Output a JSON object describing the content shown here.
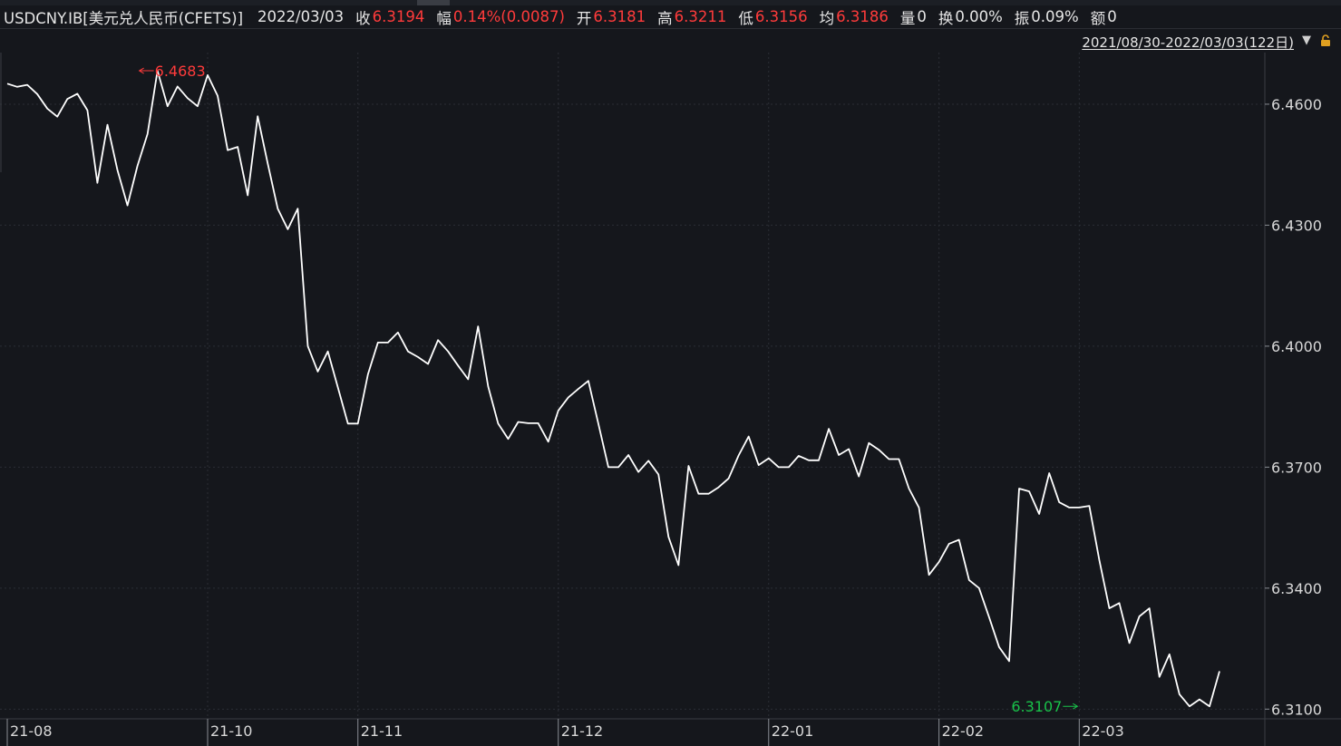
{
  "header": {
    "symbol": "USDCNY.IB[美元兑人民币(CFETS)]",
    "date": "2022/03/03",
    "close_label": "收",
    "close": "6.3194",
    "change_label": "幅",
    "change": "0.14%(0.0087)",
    "open_label": "开",
    "open": "6.3181",
    "high_label": "高",
    "high": "6.3211",
    "low_label": "低",
    "low": "6.3156",
    "avg_label": "均",
    "avg": "6.3186",
    "volume_label": "量",
    "volume": "0",
    "turnover_label": "换",
    "turnover": "0.00%",
    "amplitude_label": "振",
    "amplitude": "0.09%",
    "amount_label": "额",
    "amount": "0"
  },
  "range_selector": {
    "label": "2021/08/30-2022/03/03(122日)",
    "dropdown_icon": "triangle-down-icon",
    "lock_icon": "lock-icon"
  },
  "colors": {
    "background": "#15171c",
    "line": "#ffffff",
    "up": "#ff3b3b",
    "down": "#19c24a",
    "grid": "#2b2e35"
  },
  "chart_data": {
    "type": "line",
    "title": "",
    "xlabel": "",
    "ylabel": "",
    "ylim": [
      6.3076,
      6.4728
    ],
    "y_ticks": [
      "6.4600",
      "6.4300",
      "6.4000",
      "6.3700",
      "6.3400",
      "6.3100"
    ],
    "x_ticks": [
      {
        "label": "21-08",
        "index": 0
      },
      {
        "label": "21-10",
        "index": 20
      },
      {
        "label": "21-11",
        "index": 35
      },
      {
        "label": "21-12",
        "index": 55
      },
      {
        "label": "22-01",
        "index": 76
      },
      {
        "label": "22-02",
        "index": 93
      },
      {
        "label": "22-03",
        "index": 107
      }
    ],
    "grid": true,
    "max_annotation": {
      "label": "6.4683",
      "value": 6.4683,
      "index": 13
    },
    "min_annotation": {
      "label": "6.3107",
      "value": 6.3107,
      "index": 107
    },
    "series": [
      {
        "values": [
          6.4651,
          6.4643,
          6.4648,
          6.4625,
          6.4589,
          6.4569,
          6.4613,
          6.4626,
          6.4585,
          6.4405,
          6.4549,
          6.4437,
          6.4349,
          6.4447,
          6.4526,
          6.4683,
          6.4595,
          6.4644,
          6.4615,
          6.4595,
          6.4672,
          6.4621,
          6.4486,
          6.4494,
          6.4374,
          6.457,
          6.4453,
          6.4341,
          6.429,
          6.4341,
          6.4,
          6.3937,
          6.3987,
          6.3898,
          6.3808,
          6.3808,
          6.393,
          6.4009,
          6.4009,
          6.4034,
          6.3987,
          6.3973,
          6.3956,
          6.4015,
          6.3987,
          6.3952,
          6.3918,
          6.4049,
          6.39,
          6.3808,
          6.377,
          6.3812,
          6.3809,
          6.3809,
          6.3763,
          6.384,
          6.3873,
          6.3894,
          6.3914,
          6.3808,
          6.37,
          6.37,
          6.373,
          6.3688,
          6.3716,
          6.3682,
          6.3527,
          6.3457,
          6.3703,
          6.3634,
          6.3634,
          6.365,
          6.3672,
          6.3729,
          6.3776,
          6.3705,
          6.3722,
          6.37,
          6.37,
          6.3728,
          6.3717,
          6.3717,
          6.3795,
          6.373,
          6.3745,
          6.3677,
          6.376,
          6.3743,
          6.372,
          6.372,
          6.3647,
          6.36,
          6.3433,
          6.3465,
          6.351,
          6.352,
          6.342,
          6.34,
          6.3328,
          6.3254,
          6.3219,
          6.3647,
          6.364,
          6.3584,
          6.3685,
          6.3613,
          6.36,
          6.36,
          6.3604,
          6.347,
          6.335,
          6.3363,
          6.3264,
          6.333,
          6.335,
          6.318,
          6.3236,
          6.3137,
          6.3107,
          6.3124,
          6.3107,
          6.3194
        ]
      }
    ]
  }
}
